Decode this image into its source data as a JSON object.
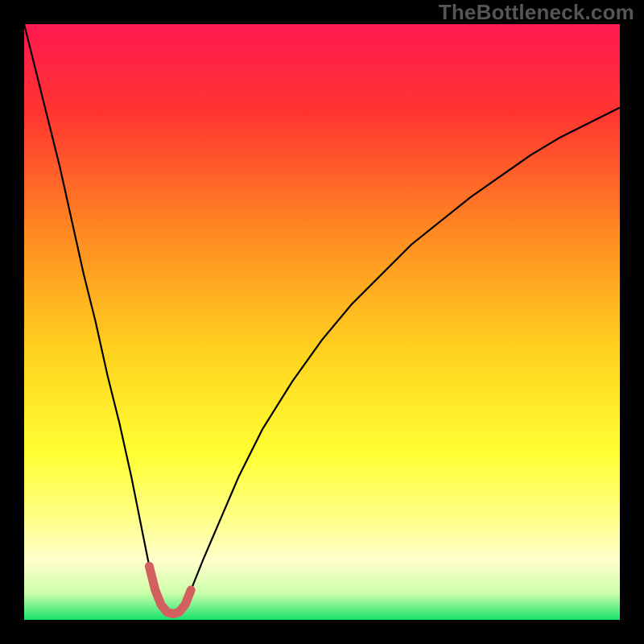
{
  "watermark": "TheBottleneck.com",
  "chart_data": {
    "type": "line",
    "title": "",
    "xlabel": "",
    "ylabel": "",
    "xlim": [
      0,
      100
    ],
    "ylim": [
      0,
      100
    ],
    "grid": false,
    "legend": false,
    "background_gradient": [
      {
        "pos": 0.0,
        "color": "#ff1950"
      },
      {
        "pos": 0.15,
        "color": "#ff3530"
      },
      {
        "pos": 0.35,
        "color": "#ff8a22"
      },
      {
        "pos": 0.55,
        "color": "#ffd21e"
      },
      {
        "pos": 0.72,
        "color": "#ffff33"
      },
      {
        "pos": 0.82,
        "color": "#ffff80"
      },
      {
        "pos": 0.9,
        "color": "#ffffcc"
      },
      {
        "pos": 0.955,
        "color": "#ccffaa"
      },
      {
        "pos": 1.0,
        "color": "#19e36b"
      }
    ],
    "series": [
      {
        "name": "bottleneck-curve",
        "stroke": "#000000",
        "stroke_width": 2.2,
        "x": [
          0,
          2,
          4,
          6,
          8,
          10,
          12,
          14,
          16,
          18,
          20,
          21,
          22,
          23,
          24,
          25,
          26,
          27,
          28,
          30,
          33,
          36,
          40,
          45,
          50,
          55,
          60,
          65,
          70,
          75,
          80,
          85,
          90,
          95,
          100
        ],
        "values": [
          100,
          92,
          84,
          76,
          67,
          58,
          50,
          41,
          33,
          24,
          14,
          9,
          5,
          2.5,
          1.3,
          1.0,
          1.3,
          2.5,
          5,
          10,
          17,
          24,
          32,
          40,
          47,
          53,
          58,
          63,
          67,
          71,
          74.5,
          78,
          81,
          83.5,
          86
        ]
      },
      {
        "name": "highlight-band",
        "stroke": "#d2605e",
        "stroke_width": 11,
        "linecap": "round",
        "x": [
          21,
          22,
          23,
          24,
          25,
          26,
          27,
          28
        ],
        "values": [
          9,
          5,
          2.5,
          1.3,
          1.0,
          1.3,
          2.5,
          5
        ]
      },
      {
        "name": "baseline",
        "stroke": "#19e36b",
        "stroke_width": 0,
        "x": [
          0,
          100
        ],
        "values": [
          0,
          0
        ]
      }
    ]
  }
}
